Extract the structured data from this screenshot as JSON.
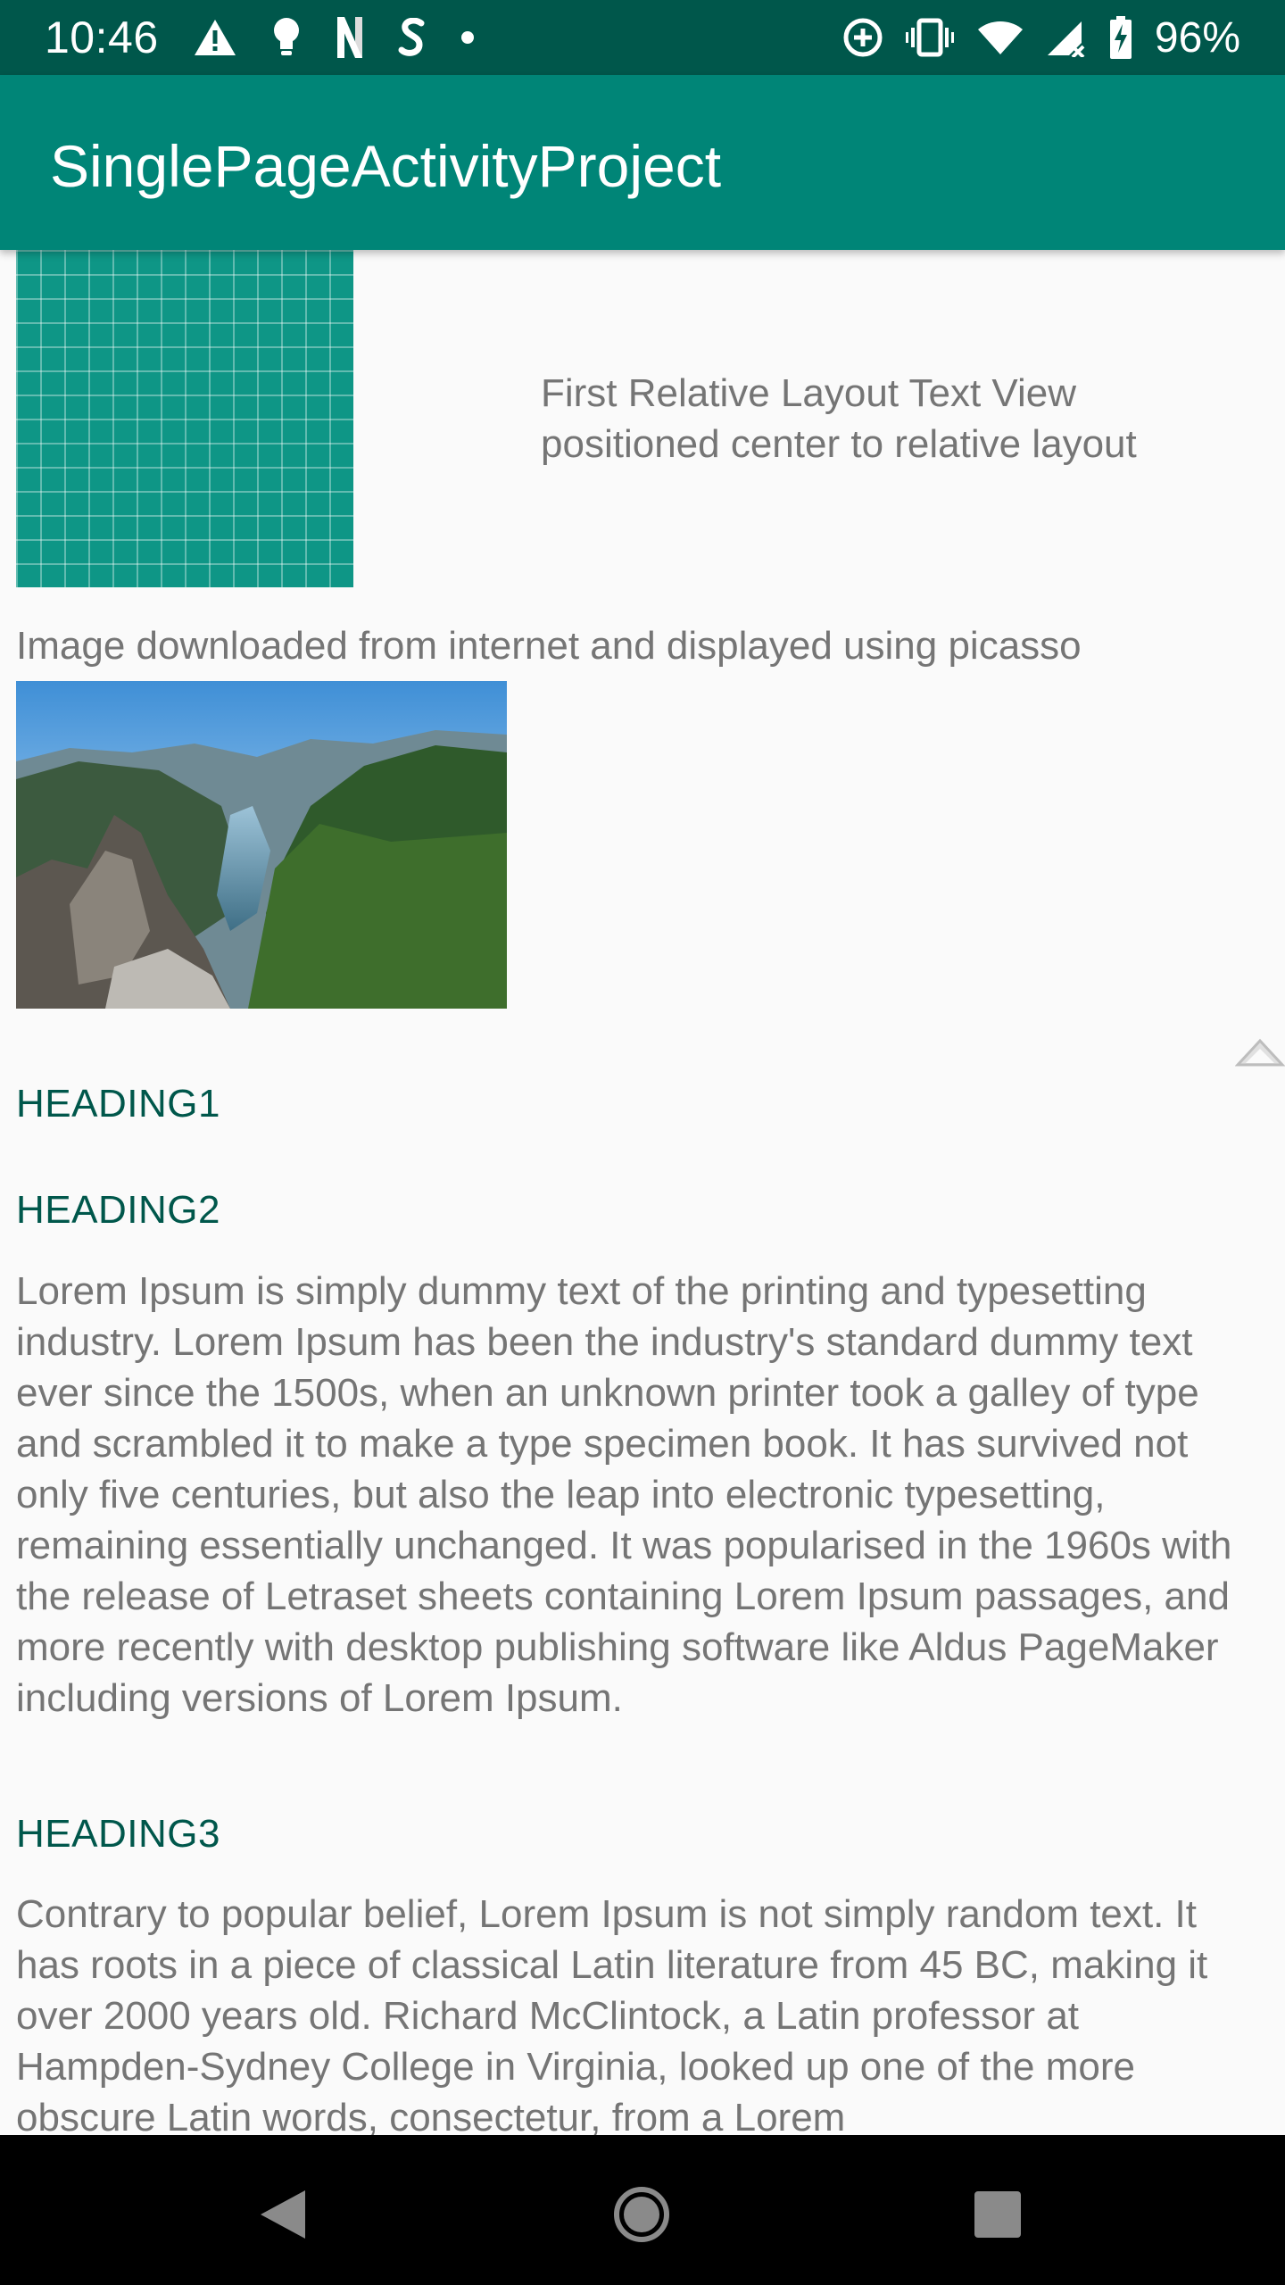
{
  "status_bar": {
    "time": "10:46",
    "battery": "96%",
    "left_icons": [
      "warning-icon",
      "lightbulb-icon",
      "n-icon",
      "s-icon",
      "dot-icon"
    ],
    "right_icons": [
      "data-saver-icon",
      "vibrate-icon",
      "wifi-icon",
      "signal-icon",
      "battery-charging-icon"
    ]
  },
  "app_bar": {
    "title": "SinglePageActivityProject"
  },
  "content": {
    "relative_text": "First Relative Layout Text View positioned center to relative layout",
    "image_caption": "Image downloaded from internet and displayed using picasso",
    "heading1": "HEADING1",
    "heading2": "HEADING2",
    "paragraph1": "Lorem Ipsum is simply dummy text of the printing and typesetting industry. Lorem Ipsum has been the industry's standard dummy text ever since the 1500s, when an unknown printer took a galley of type and scrambled it to make a type specimen book. It has survived not only five centuries, but also the leap into electronic typesetting, remaining essentially unchanged. It was popularised in the 1960s with the release of Letraset sheets containing Lorem Ipsum passages, and more recently with desktop publishing software like Aldus PageMaker including versions of Lorem Ipsum.",
    "heading3": "HEADING3",
    "paragraph2": "Contrary to popular belief, Lorem Ipsum is not simply random text. It has roots in a piece of classical Latin literature from 45 BC, making it over 2000 years old. Richard McClintock, a Latin professor at Hampden-Sydney College in Virginia, looked up one of the more obscure Latin words, consectetur, from a Lorem"
  },
  "nav_bar": {
    "buttons": [
      "back-icon",
      "home-icon",
      "recents-icon"
    ]
  },
  "colors": {
    "status_bar": "#00574b",
    "app_bar": "#008577",
    "heading": "#00574b",
    "body_text": "#757575"
  }
}
